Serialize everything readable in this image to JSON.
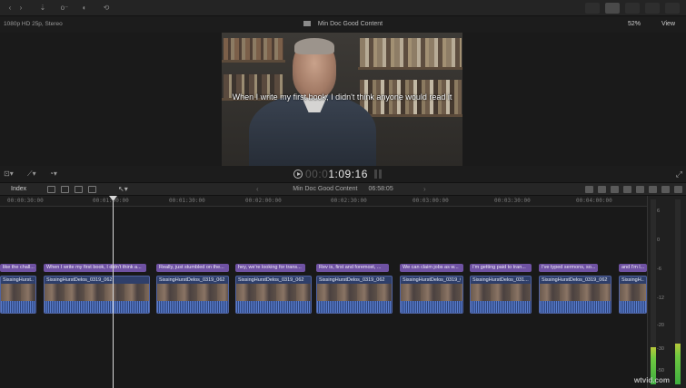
{
  "viewer": {
    "format": "1080p HD 25p, Stereo",
    "title": "Min Doc Good Content",
    "zoom": "52%",
    "view_menu": "View",
    "subtitle": "When I write my first book, I didn't think anyone would read it"
  },
  "playback": {
    "timecode_dim": "00:0",
    "timecode": "1:09:16"
  },
  "timeline": {
    "index_label": "Index",
    "project_name": "Min Doc Good Content",
    "duration": "06:58:05",
    "ruler_ticks": [
      "00:00:30:00",
      "00:01:00:00",
      "00:01:30:00",
      "00:02:00:00",
      "00:02:30:00",
      "00:03:00:00",
      "00:03:30:00",
      "00:04:00:00"
    ],
    "captions": [
      "like the chall...",
      "When I write my first book, I didn't think a...",
      "Really, just stumbled on the...",
      "hey, we're looking for trans...",
      "Rev is, first and foremost, ...",
      "We can claim jobs as w...",
      "I'm getting paid to tran...",
      "I've typed sermons, so...",
      "and I'm l..."
    ],
    "clips": [
      "SissingHurst...",
      "SissingHurstDelos_0319_062",
      "SissingHurstDelos_0319_062",
      "SissingHurstDelos_0319_062",
      "SissingHurstDelos_0319_062",
      "SissingHurstDelos_0319_062",
      "SissingHurstDelos_031...",
      "SissingHurstDelos_0319_062",
      "SissingH..."
    ]
  },
  "meters": {
    "scale": [
      "6",
      "0",
      "-6",
      "-12",
      "-20",
      "-30",
      "-50"
    ],
    "left_level": 0.2,
    "right_level": 0.22
  },
  "watermark": "wtvid.com"
}
